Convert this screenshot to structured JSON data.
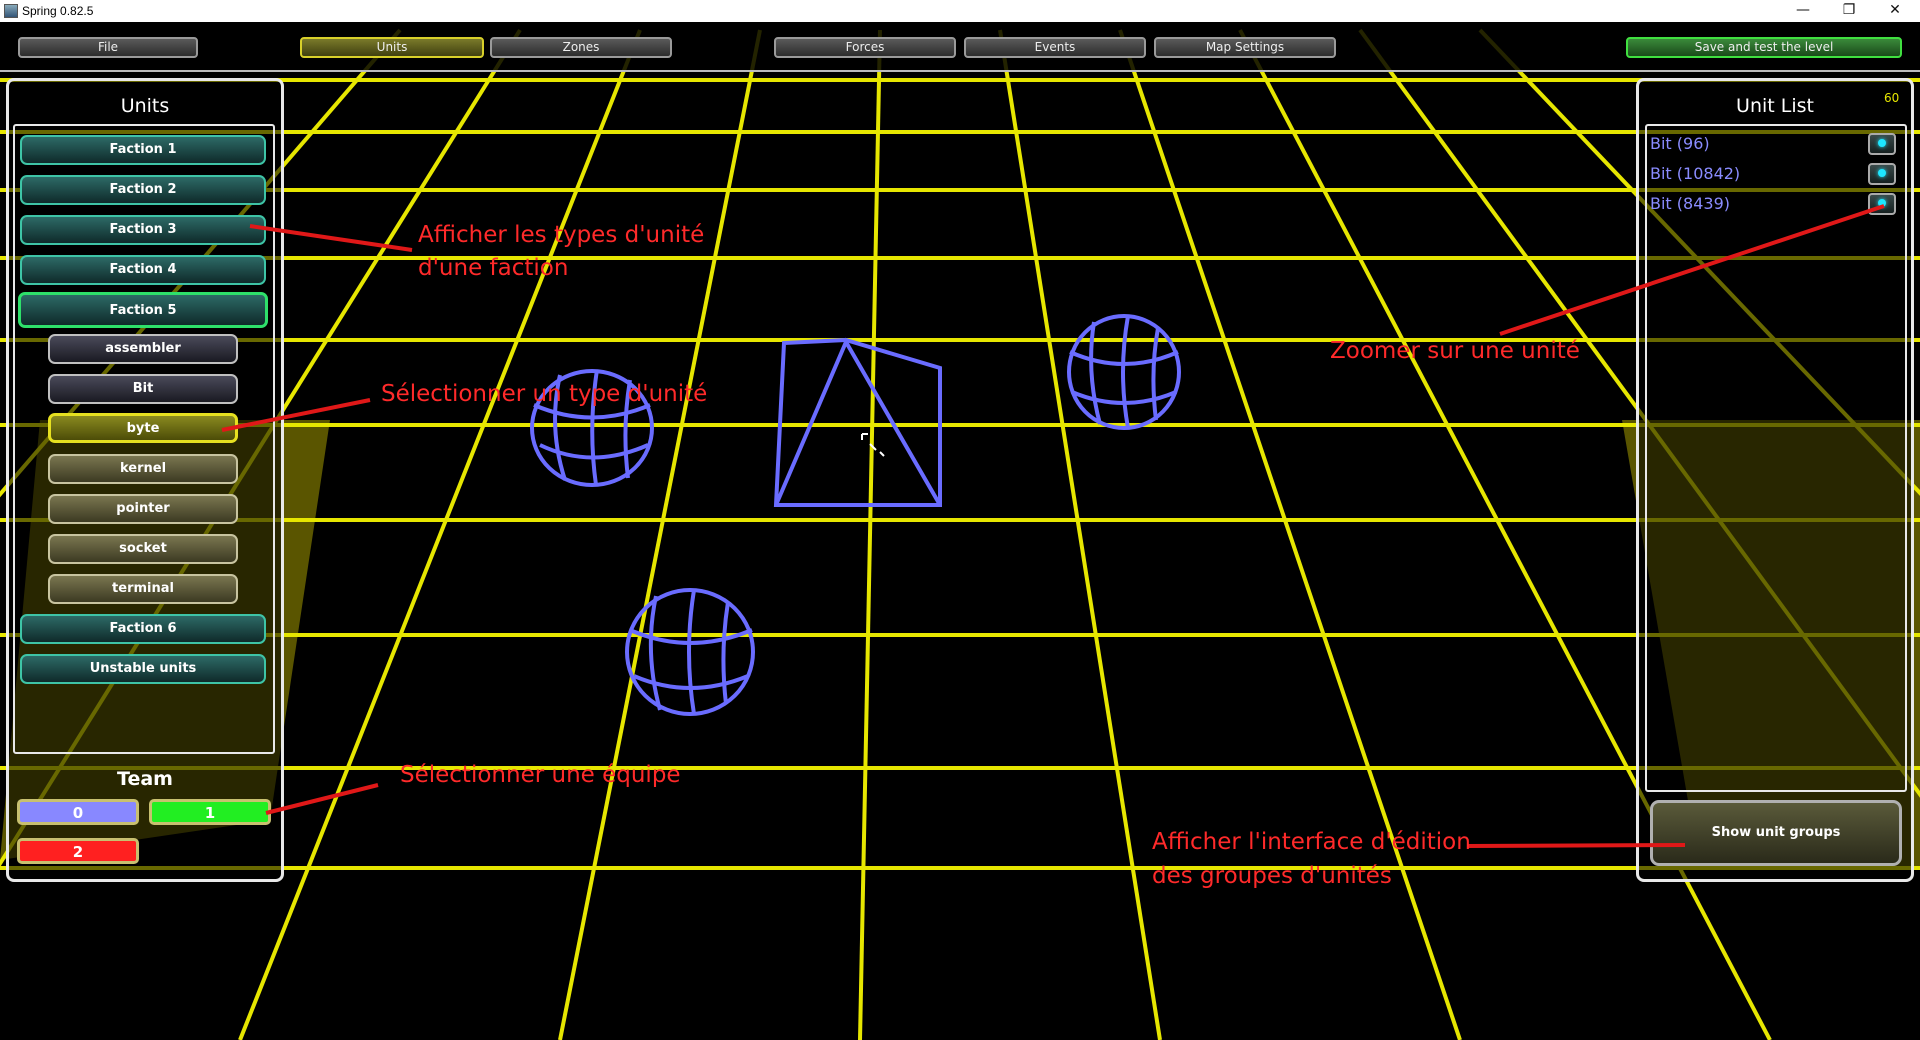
{
  "window": {
    "title": "Spring 0.82.5",
    "controls": {
      "minimize": "—",
      "restore": "❐",
      "close": "✕"
    }
  },
  "menu": {
    "file": "File",
    "units": "Units",
    "zones": "Zones",
    "forces": "Forces",
    "events": "Events",
    "map_settings": "Map Settings",
    "save_test": "Save and test the level"
  },
  "units_panel": {
    "title": "Units",
    "factions": [
      "Faction 1",
      "Faction 2",
      "Faction 3",
      "Faction 4",
      "Faction 5"
    ],
    "unit_types": [
      "assembler",
      "Bit",
      "byte",
      "kernel",
      "pointer",
      "socket",
      "terminal"
    ],
    "selected_unit_type": "byte",
    "faction_6": "Faction 6",
    "unstable": "Unstable units"
  },
  "team_panel": {
    "title": "Team",
    "teams": [
      "0",
      "1",
      "2"
    ],
    "colors": {
      "team0": "#8888ff",
      "team1": "#22ee22",
      "team2": "#ff2020"
    }
  },
  "unit_list": {
    "title": "Unit List",
    "fps": "60",
    "units": [
      "Bit (96)",
      "Bit (10842)",
      "Bit (8439)"
    ],
    "show_groups": "Show unit groups"
  },
  "annotations": {
    "faction_line1": "Afficher les types d'unité",
    "faction_line2": "d'une faction",
    "unit_type": "Sélectionner un type d'unité",
    "team": "Sélectionner une équipe",
    "zoom": "Zoomer sur une unité",
    "groups_line1": "Afficher l'interface d'édition",
    "groups_line2": "des groupes d'unités"
  },
  "colors": {
    "grid": "#e6e600",
    "unit_wireframe": "#6a6cff",
    "annotation": "#ff2a2a",
    "faction_border": "#3ec4a6"
  }
}
